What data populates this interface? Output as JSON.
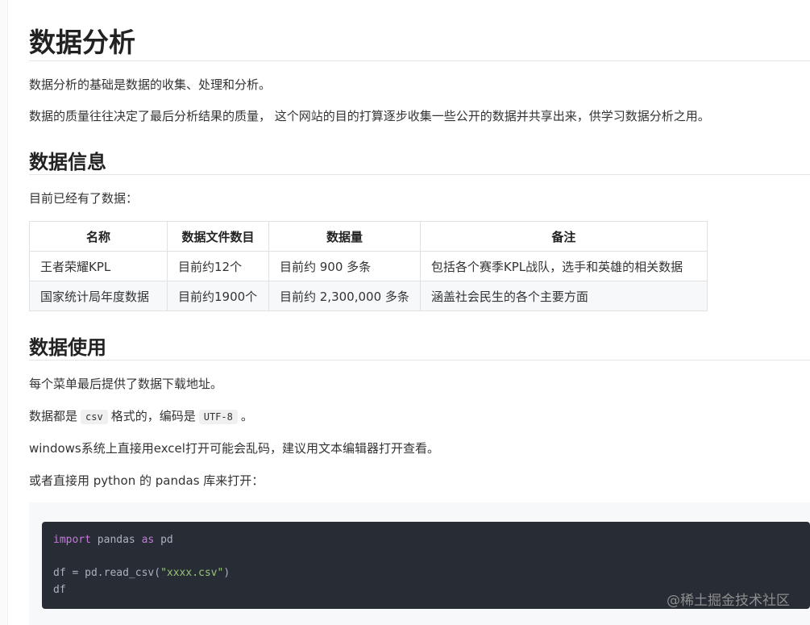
{
  "title": "数据分析",
  "intro": [
    "数据分析的基础是数据的收集、处理和分析。",
    "数据的质量往往决定了最后分析结果的质量， 这个网站的目的打算逐步收集一些公开的数据并共享出来，供学习数据分析之用。"
  ],
  "info": {
    "heading": "数据信息",
    "lead": "目前已经有了数据：",
    "headers": [
      "名称",
      "数据文件数目",
      "数据量",
      "备注"
    ],
    "rows": [
      [
        "王者荣耀KPL",
        "目前约12个",
        "目前约 900 多条",
        "包括各个赛季KPL战队，选手和英雄的相关数据"
      ],
      [
        "国家统计局年度数据",
        "目前约1900个",
        "目前约 2,300,000 多条",
        "涵盖社会民生的各个主要方面"
      ]
    ]
  },
  "usage": {
    "heading": "数据使用",
    "p1": "每个菜单最后提供了数据下载地址。",
    "p2_before": "数据都是",
    "p2_code1": "csv",
    "p2_middle": "格式的，编码是",
    "p2_code2": "UTF-8",
    "p2_after": "。",
    "p3": "windows系统上直接用excel打开可能会乱码，建议用文本编辑器打开查看。",
    "p4": "或者直接用 python 的 pandas 库来打开："
  },
  "code": {
    "l1_kw1": "import",
    "l1_mid": " pandas ",
    "l1_kw2": "as",
    "l1_end": " pd",
    "l2_start": "df = pd.read_csv(",
    "l2_str": "\"xxxx.csv\"",
    "l2_end": ")",
    "l3": "df"
  },
  "watermark": "@稀土掘金技术社区"
}
